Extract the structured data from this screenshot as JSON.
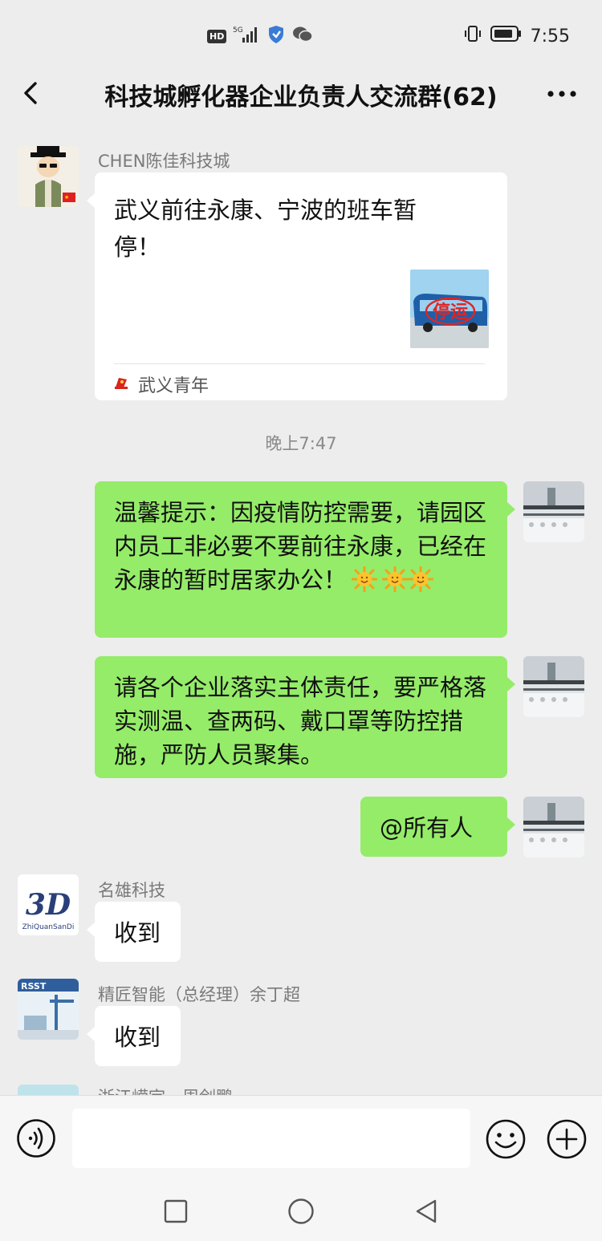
{
  "status_bar": {
    "hd": "HD",
    "network": "5G",
    "time": "7:55",
    "icons": [
      "hd-icon",
      "signal-icon",
      "shield-icon",
      "wechat-icon",
      "vibrate-icon",
      "battery-icon"
    ]
  },
  "header": {
    "title": "科技城孵化器企业负责人交流群(62)"
  },
  "messages": [
    {
      "sender": "CHEN陈佳科技城",
      "card_title": "武义前往永康、宁波的班车暂停！",
      "card_source": "武义青年",
      "thumb_label": "停运"
    },
    {
      "time_separator": "晚上7:47"
    },
    {
      "text": "温馨提示：因疫情防控需要，请园区内员工非必要不要前往永康，已经在永康的暂时居家办公！"
    },
    {
      "text": "请各个企业落实主体责任，要严格落实测温、查两码、戴口罩等防控措施，严防人员聚集。"
    },
    {
      "text": "@所有人"
    },
    {
      "sender": "名雄科技",
      "text": "收到",
      "avatar_text": "3D",
      "avatar_sub": "ZhiQuanSanDi"
    },
    {
      "sender": "精匠智能（总经理）余丁超",
      "text": "收到",
      "avatar_text": "RSST"
    },
    {
      "sender": "浙江嵘宇一周剑鹏"
    }
  ],
  "input_bar": {
    "placeholder": ""
  },
  "colors": {
    "background": "#ededed",
    "self_bubble": "#95ec69",
    "other_bubble": "#ffffff"
  }
}
